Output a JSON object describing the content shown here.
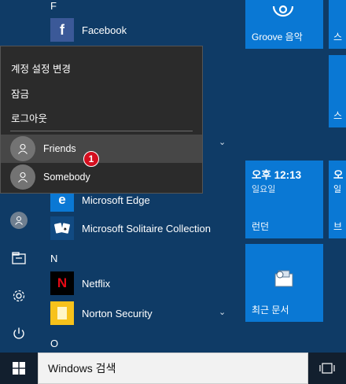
{
  "app_list": {
    "letter_f": "F",
    "facebook": "Facebook",
    "edge": "Microsoft Edge",
    "solitaire": "Microsoft Solitaire Collection",
    "letter_n": "N",
    "netflix": "Netflix",
    "norton": "Norton Security",
    "letter_o": "O"
  },
  "flyout": {
    "change_settings": "계정 설정 변경",
    "lock": "잠금",
    "sign_out": "로그아웃",
    "users": [
      "Friends",
      "Somebody"
    ],
    "badge": "1"
  },
  "tiles": {
    "groove": "Groove 음악",
    "clock_time": "오후 12:13",
    "clock_day": "일요일",
    "calendar": "런던",
    "recent_docs": "최근 문서",
    "partial_right_1": "오",
    "partial_right_2": "일",
    "partial_right_3": "브",
    "partial_right_4": "스"
  },
  "taskbar": {
    "search_placeholder": "Windows 검색"
  },
  "colors": {
    "background": "#0f3b66",
    "tile": "#0a78d4",
    "flyout": "#2b2b2b",
    "badge": "#d40f1f"
  },
  "icons": {
    "start": "windows-logo-icon",
    "task_view": "task-view-icon",
    "power": "power-icon",
    "settings": "gear-icon",
    "explorer": "file-explorer-icon",
    "avatar": "user-avatar-icon"
  }
}
